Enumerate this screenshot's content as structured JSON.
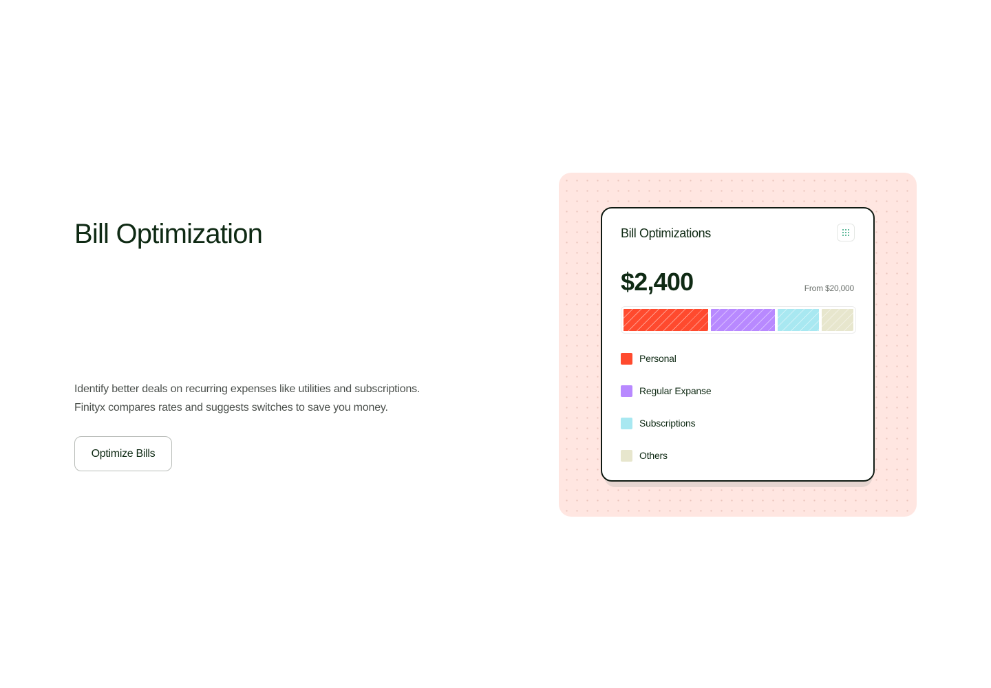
{
  "section": {
    "title": "Bill Optimization",
    "description_lines": [
      "Identify better deals on recurring expenses like utilities and subscriptions.",
      "Finityx compares rates and suggests switches to save you money."
    ],
    "cta_label": "Optimize Bills"
  },
  "card": {
    "title": "Bill Optimizations",
    "menu_icon": "grid-dots-icon",
    "amount": "$2,400",
    "from_text": "From $20,000",
    "categories": [
      {
        "label": "Personal",
        "color": "#ff4a2e",
        "share": 37
      },
      {
        "label": "Regular Expanse",
        "color": "#b889ff",
        "share": 28
      },
      {
        "label": "Subscriptions",
        "color": "#a8e8f1",
        "share": 18
      },
      {
        "label": "Others",
        "color": "#e7e6cd",
        "share": 14
      }
    ]
  },
  "colors": {
    "panel_bg": "#ffe6e1",
    "text_primary": "#0f2a14",
    "icon_accent": "#2aa37a"
  }
}
